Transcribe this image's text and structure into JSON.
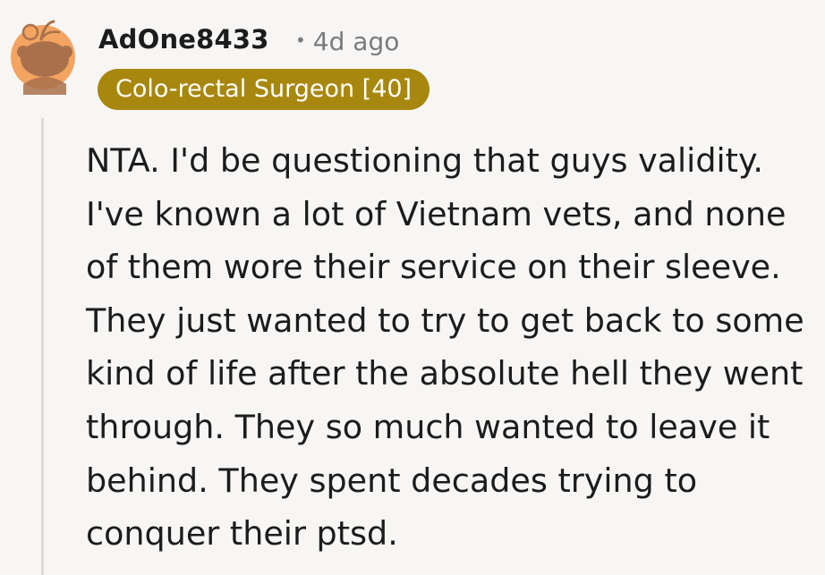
{
  "comment": {
    "username": "AdOne8433",
    "separator": "•",
    "timestamp": "4d ago",
    "flair": "Colo-rectal Surgeon [40]",
    "body": "NTA. I'd be questioning that guys validity.\nI've known a lot of Vietnam vets, and none\nof them wore their service on their sleeve.\nThey just wanted to try to get back to some\nkind of life after the absolute hell they went\nthrough. They so much wanted to leave it\nbehind. They spent decades trying to\nconquer their ptsd.",
    "avatar_icon": "snoo-avatar-icon",
    "colors": {
      "flair_bg": "#a8870e",
      "avatar_bg": "#f4a461",
      "avatar_head": "#a9714b",
      "background": "#f7f6f4"
    }
  }
}
